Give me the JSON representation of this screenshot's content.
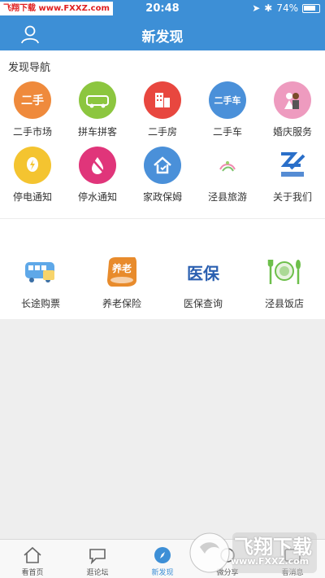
{
  "status": {
    "watermark": "飞翔下载 www.FXXZ.com",
    "time": "20:48",
    "battery": "74%"
  },
  "header": {
    "title": "新发现",
    "profile_icon": "user-icon"
  },
  "section": {
    "title": "发现导航"
  },
  "nav_items": [
    {
      "label": "二手市场",
      "icon_text": "二手",
      "color": "#ef8a3c"
    },
    {
      "label": "拼车拼客",
      "icon_text": "拼车",
      "color": "#8cc63f"
    },
    {
      "label": "二手房",
      "icon_text": "",
      "color": "#e8473f"
    },
    {
      "label": "二手车",
      "icon_text": "二手车",
      "color": "#4a90d9"
    },
    {
      "label": "婚庆服务",
      "icon_text": "",
      "color": "#ee9bbf"
    },
    {
      "label": "停电通知",
      "icon_text": "",
      "color": "#f4c430"
    },
    {
      "label": "停水通知",
      "icon_text": "",
      "color": "#e0357a"
    },
    {
      "label": "家政保姆",
      "icon_text": "",
      "color": "#4a90d9"
    },
    {
      "label": "泾县旅游",
      "icon_text": "",
      "color": "#ffffff"
    },
    {
      "label": "关于我们",
      "icon_text": "",
      "color": "#ffffff"
    }
  ],
  "services": [
    {
      "label": "长途购票",
      "icon": "bus-icon"
    },
    {
      "label": "养老保险",
      "icon_text": "养老",
      "icon": "pension-icon"
    },
    {
      "label": "医保查询",
      "icon_text": "医保",
      "icon": "medical-insurance-icon"
    },
    {
      "label": "泾县饭店",
      "icon": "restaurant-icon"
    }
  ],
  "tabs": [
    {
      "label": "看首页"
    },
    {
      "label": "逛论坛"
    },
    {
      "label": "新发现"
    },
    {
      "label": "微分享"
    },
    {
      "label": "看消息"
    }
  ],
  "overlay_watermark": {
    "name": "飞翔下载",
    "url": "www.FXXZ.com"
  },
  "colors": {
    "primary": "#3d8fd6"
  }
}
